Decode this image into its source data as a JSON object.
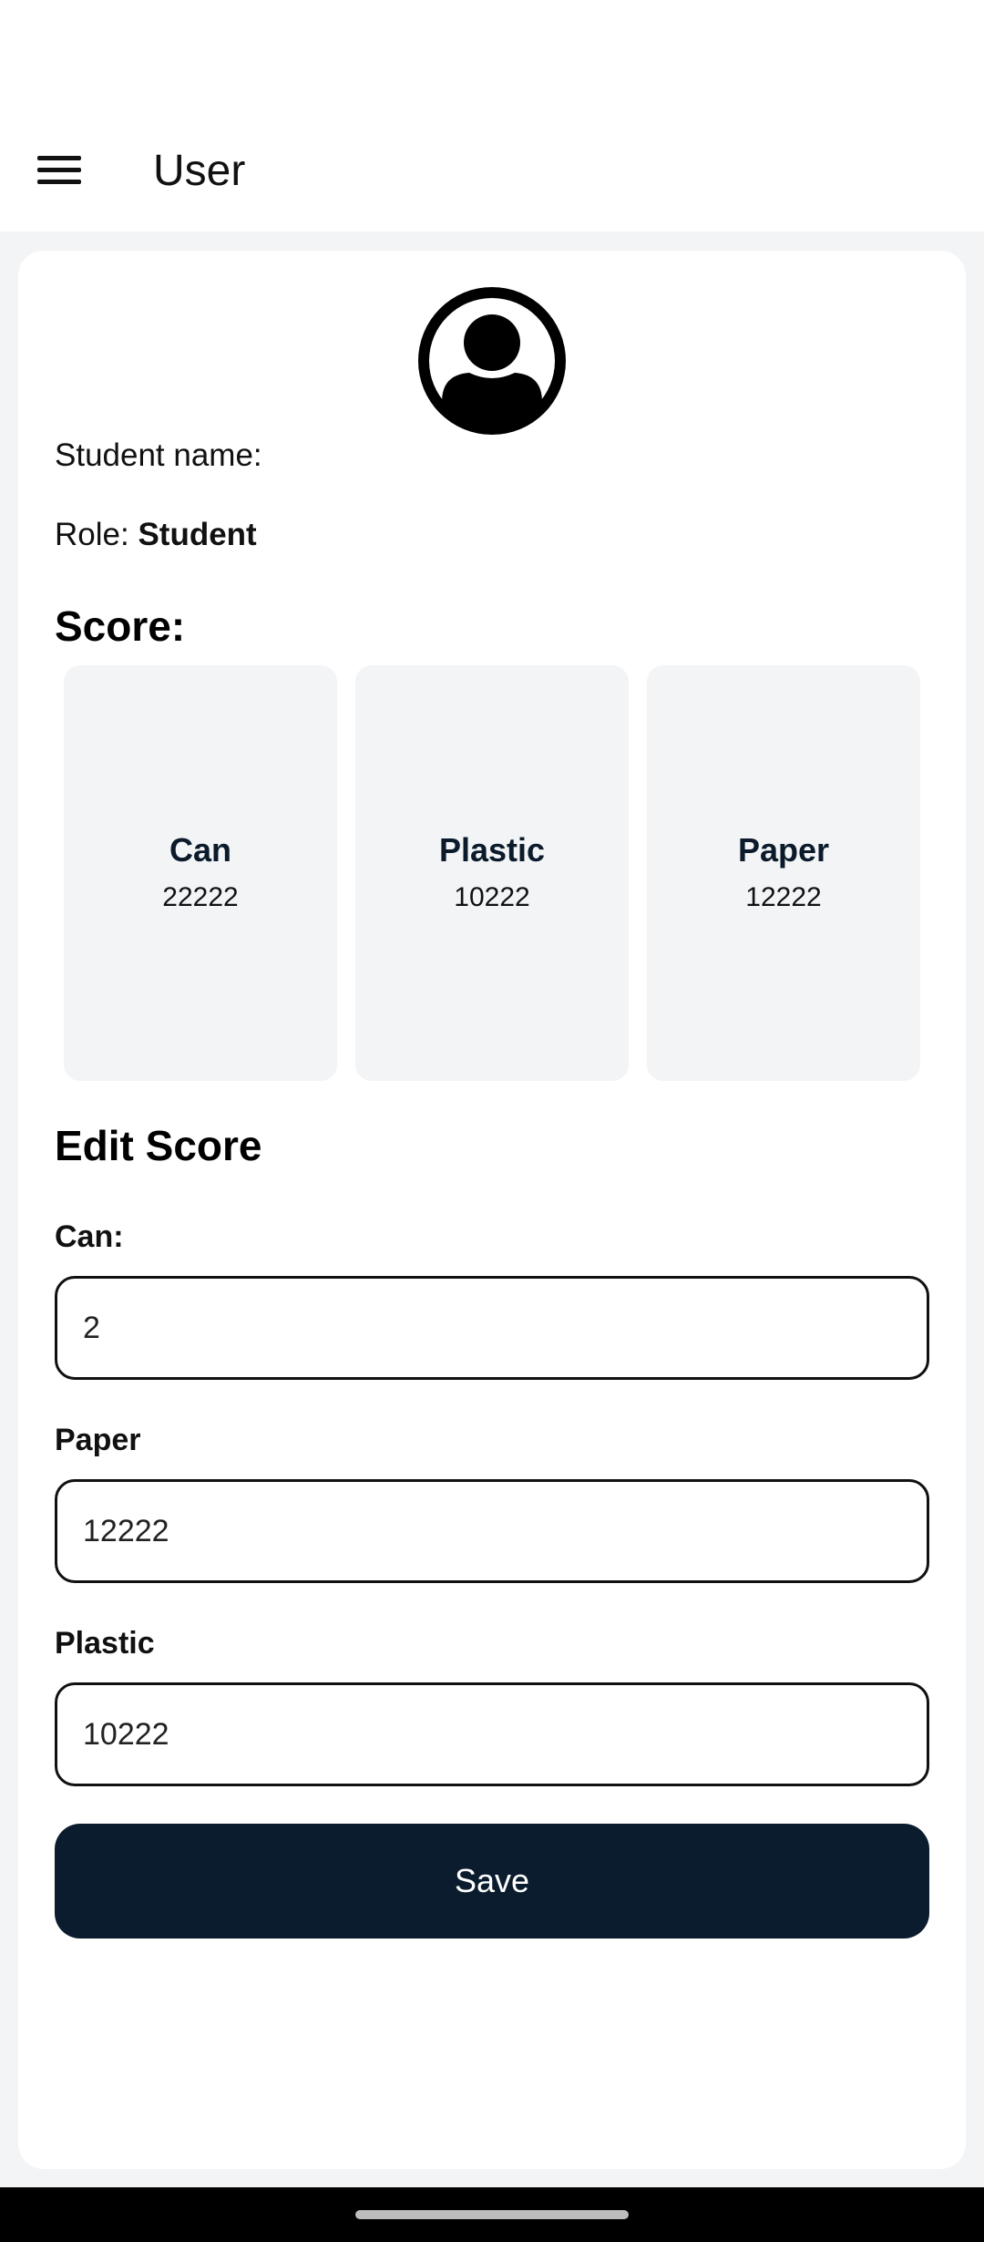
{
  "app_bar": {
    "title": "User",
    "menu_icon": "hamburger-menu-icon"
  },
  "profile": {
    "avatar_icon": "user-avatar-icon",
    "student_name_label": "Student name:",
    "role_label": "Role:",
    "role_value": "Student"
  },
  "score": {
    "title": "Score:",
    "tiles": [
      {
        "name": "Can",
        "value": "22222"
      },
      {
        "name": "Plastic",
        "value": "10222"
      },
      {
        "name": "Paper",
        "value": "12222"
      }
    ]
  },
  "edit_score": {
    "title": "Edit Score",
    "fields": [
      {
        "label": "Can:",
        "value": "2"
      },
      {
        "label": "Paper",
        "value": "12222"
      },
      {
        "label": "Plastic",
        "value": "10222"
      }
    ],
    "save_label": "Save"
  },
  "colors": {
    "primary_button": "#0a1c2e",
    "background": "#f3f4f6",
    "tile": "#f3f4f6"
  }
}
